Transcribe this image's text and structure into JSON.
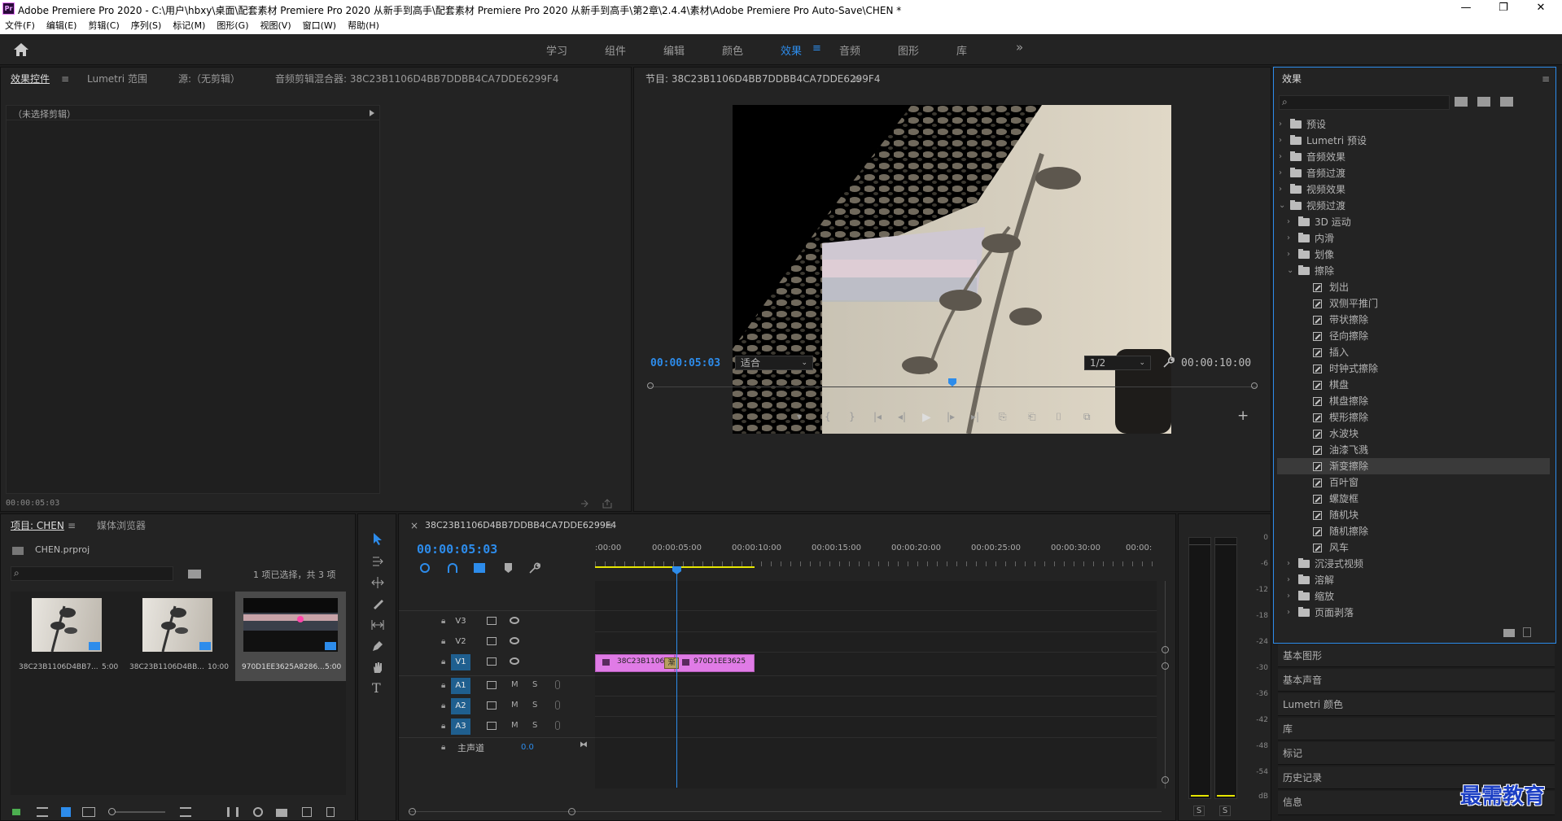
{
  "window": {
    "title": "Adobe Premiere Pro 2020 - C:\\用户\\hbxy\\桌面\\配套素材 Premiere Pro 2020 从新手到高手\\配套素材 Premiere Pro 2020 从新手到高手\\第2章\\2.4.4\\素材\\Adobe Premiere Pro Auto-Save\\CHEN *",
    "logo": "Pr",
    "minimize": "—",
    "restore": "❐",
    "close": "✕"
  },
  "menu": [
    "文件(F)",
    "编辑(E)",
    "剪辑(C)",
    "序列(S)",
    "标记(M)",
    "图形(G)",
    "视图(V)",
    "窗口(W)",
    "帮助(H)"
  ],
  "workspaces": {
    "tabs": [
      "学习",
      "组件",
      "编辑",
      "颜色",
      "效果",
      "音频",
      "图形",
      "库"
    ],
    "active_index": 4,
    "more": "»",
    "active_menu": "≡"
  },
  "source_panel": {
    "tabs": [
      "效果控件",
      "Lumetri 范围",
      "源:（无剪辑）",
      "音频剪辑混合器: 38C23B1106D4BB7DDBB4CA7DDE6299F4"
    ],
    "tab_menu": "≡",
    "no_clip": "（未选择剪辑）",
    "timecode": "00:00:05:03"
  },
  "program_panel": {
    "title": "节目: 38C23B1106D4BB7DDBB4CA7DDE6299F4",
    "menu": "≡",
    "timecode": "00:00:05:03",
    "fit": "适合",
    "resolution": "1/2",
    "duration": "00:00:10:00",
    "playhead_fraction": 0.5,
    "transport": [
      "▾",
      "{",
      "}",
      "|◂",
      "◂|",
      "▶",
      "|▸",
      "▸|",
      "⎘",
      "⎗",
      "⌷",
      "⧉"
    ],
    "add": "+"
  },
  "effects_panel": {
    "title": "效果",
    "menu": "≡",
    "search_icon": "⌕",
    "top_items": [
      "预设",
      "Lumetri 预设",
      "音频效果",
      "音频过渡",
      "视频效果"
    ],
    "video_transitions": "视频过渡",
    "sub_folders_before": [
      "3D 运动",
      "内滑",
      "划像"
    ],
    "wipe_folder": "擦除",
    "wipe_items": [
      "划出",
      "双侧平推门",
      "带状擦除",
      "径向擦除",
      "插入",
      "时钟式擦除",
      "棋盘",
      "棋盘擦除",
      "楔形擦除",
      "水波块",
      "油漆飞溅",
      "渐变擦除",
      "百叶窗",
      "螺旋框",
      "随机块",
      "随机擦除",
      "风车"
    ],
    "selected_wipe": "渐变擦除",
    "sub_folders_after": [
      "沉浸式视频",
      "溶解",
      "缩放",
      "页面剥落"
    ],
    "collapsed_arrow": "›",
    "expanded_arrow": "⌄"
  },
  "side_panels": [
    "基本图形",
    "基本声音",
    "Lumetri 颜色",
    "库",
    "标记",
    "历史记录",
    "信息"
  ],
  "project_panel": {
    "tabs": [
      "项目: CHEN",
      "媒体浏览器"
    ],
    "tab_menu": "≡",
    "file": "CHEN.prproj",
    "search_icon": "⌕",
    "selection": "1 项已选择，共 3 项",
    "items": [
      {
        "name": "38C23B1106D4BB7...",
        "duration": "5:00"
      },
      {
        "name": "38C23B1106D4BB...",
        "duration": "10:00"
      },
      {
        "name": "970D1EE3625A8286...",
        "duration": "5:00"
      }
    ]
  },
  "timeline": {
    "close": "×",
    "name": "38C23B1106D4BB7DDBB4CA7DDE6299F4",
    "menu": "≡",
    "timecode": "00:00:05:03",
    "ruler": [
      ":00:00",
      "00:00:05:00",
      "00:00:10:00",
      "00:00:15:00",
      "00:00:20:00",
      "00:00:25:00",
      "00:00:30:00",
      "00:00:"
    ],
    "video_tracks": [
      "V3",
      "V2",
      "V1"
    ],
    "audio_tracks": [
      "A1",
      "A2",
      "A3"
    ],
    "master": "主声道",
    "master_value": "0.0",
    "m": "M",
    "s": "S",
    "clip1": "38C23B1106",
    "clip2": "970D1EE3625",
    "transition_label": "渐",
    "playhead_seconds": 5.1
  },
  "meter": {
    "ticks": [
      "0",
      "-6",
      "-12",
      "-18",
      "-24",
      "-30",
      "-36",
      "-42",
      "-48",
      "-54",
      "dB"
    ],
    "s_left": "S",
    "s_right": "S"
  },
  "watermark": "最需教育"
}
